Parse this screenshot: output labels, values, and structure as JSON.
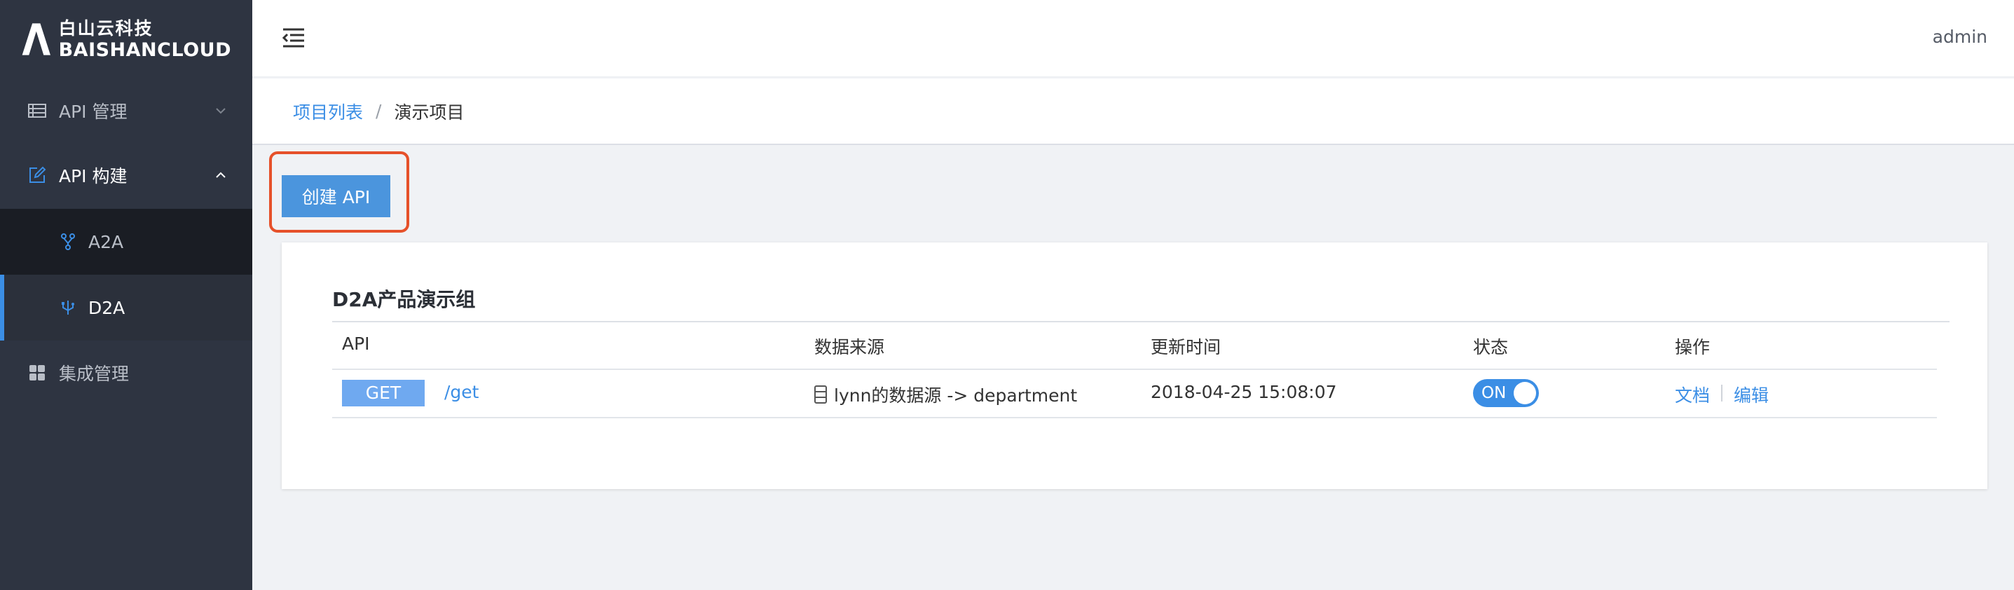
{
  "brand": {
    "name_cn": "白山云科技",
    "name_en": "BAISHANCLOUD"
  },
  "sidebar": {
    "items": [
      {
        "label": "API 管理",
        "icon": "list-icon",
        "expanded": false
      },
      {
        "label": "API 构建",
        "icon": "edit-icon",
        "expanded": true,
        "children": [
          {
            "label": "A2A",
            "icon": "fork-icon",
            "active": false
          },
          {
            "label": "D2A",
            "icon": "usb-icon",
            "active": true
          }
        ]
      },
      {
        "label": "集成管理",
        "icon": "grid-icon"
      }
    ]
  },
  "header": {
    "user": "admin"
  },
  "breadcrumb": {
    "parent": "项目列表",
    "separator": "/",
    "current": "演示项目"
  },
  "toolbar": {
    "create_label": "创建 API"
  },
  "group": {
    "title": "D2A产品演示组",
    "columns": [
      "API",
      "数据来源",
      "更新时间",
      "状态",
      "操作"
    ],
    "rows": [
      {
        "method": "GET",
        "path": "/get",
        "source": "lynn的数据源 -> department",
        "updated": "2018-04-25 15:08:07",
        "status": "ON",
        "actions": {
          "doc": "文档",
          "edit": "编辑"
        }
      }
    ]
  },
  "colors": {
    "sidebar_bg": "#2e3441",
    "accent": "#3b8ee5",
    "highlight": "#e6512a",
    "badge_get": "#6fa9f0"
  }
}
